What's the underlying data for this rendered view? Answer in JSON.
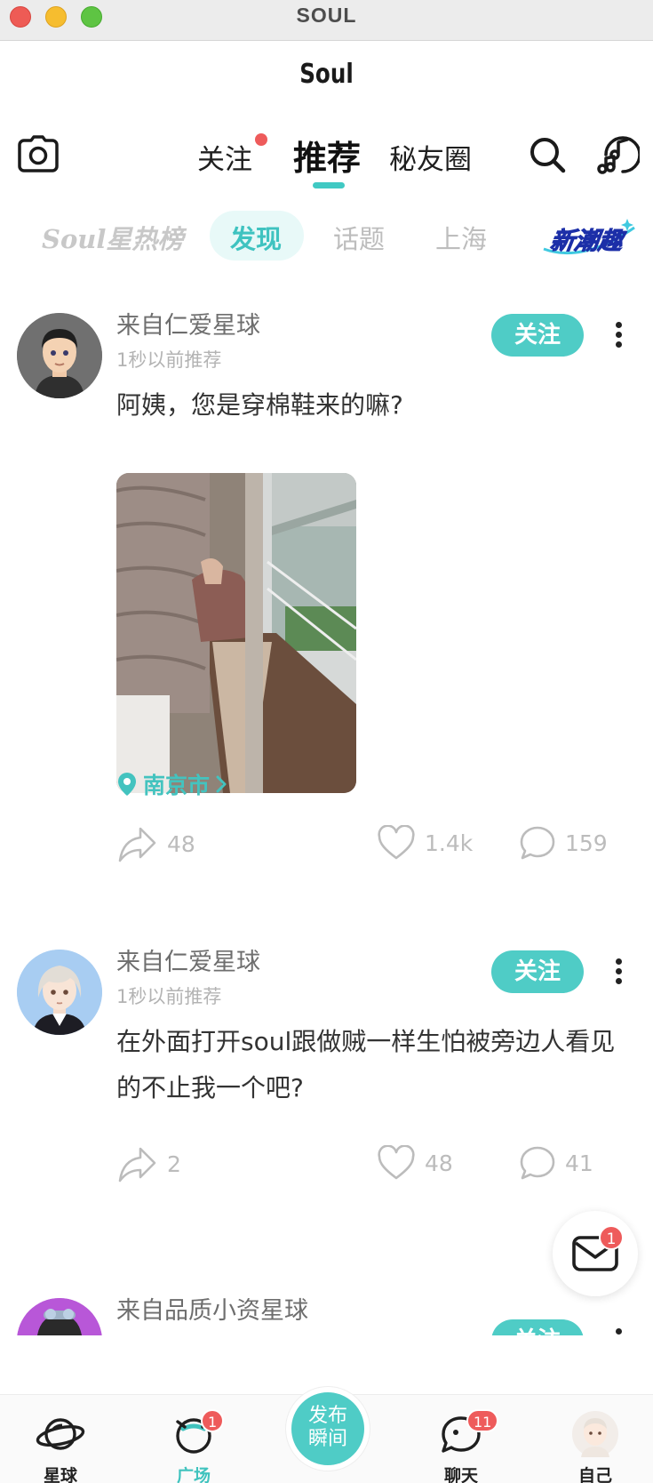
{
  "window": {
    "title": "SOUL"
  },
  "app": {
    "logo": "Soul"
  },
  "header": {
    "tabs": [
      {
        "label": "关注",
        "has_dot": true
      },
      {
        "label": "推荐",
        "active": true
      },
      {
        "label": "秘友圈"
      }
    ]
  },
  "subtabs": [
    {
      "label": "Soul星热榜"
    },
    {
      "label": "发现",
      "active": true
    },
    {
      "label": "话题"
    },
    {
      "label": "上海"
    },
    {
      "label": "新潮趣"
    }
  ],
  "posts": [
    {
      "author": "来自仁爱星球",
      "time": "1秒以前推荐",
      "follow_label": "关注",
      "text": "阿姨，您是穿棉鞋来的嘛?",
      "location": "南京市",
      "shares": "48",
      "likes": "1.4k",
      "comments": "159"
    },
    {
      "author": "来自仁爱星球",
      "time": "1秒以前推荐",
      "follow_label": "关注",
      "text": "在外面打开soul跟做贼一样生怕被旁边人看见的不止我一个吧?",
      "shares": "2",
      "likes": "48",
      "comments": "41"
    },
    {
      "author": "来自品质小资星球",
      "follow_label": "关注"
    }
  ],
  "mail": {
    "badge": "1"
  },
  "bottom_nav": {
    "items": [
      {
        "label": "星球"
      },
      {
        "label": "广场",
        "badge": "1",
        "active": true
      },
      {
        "label": "自己"
      }
    ],
    "chat": {
      "label": "聊天",
      "badge": "11"
    },
    "publish": {
      "line1": "发布",
      "line2": "瞬间"
    }
  },
  "colors": {
    "accent": "#4fccc6",
    "badge": "#ee5b5b",
    "location": "#43c3bf"
  }
}
